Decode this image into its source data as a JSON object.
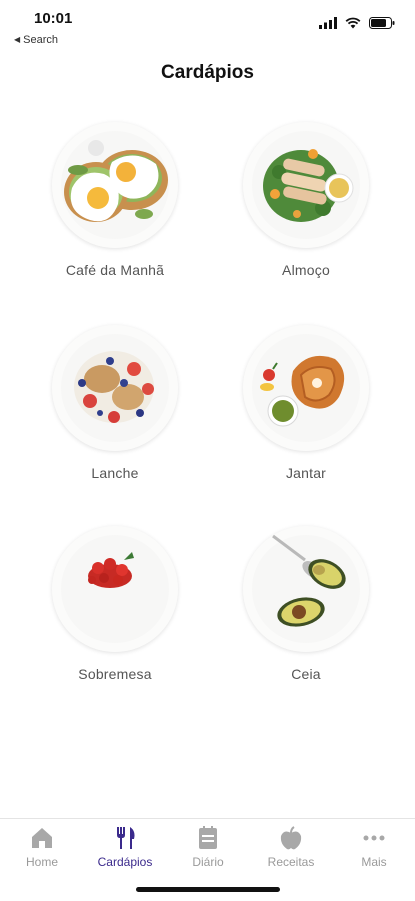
{
  "status_bar": {
    "time": "10:01",
    "back_label": "Search"
  },
  "page": {
    "title": "Cardápios"
  },
  "menus": [
    {
      "label": "Café da Manhã",
      "image": "breakfast-eggs-plate"
    },
    {
      "label": "Almoço",
      "image": "salad-chicken-plate"
    },
    {
      "label": "Lanche",
      "image": "granola-berries-plate"
    },
    {
      "label": "Jantar",
      "image": "salmon-steak-plate"
    },
    {
      "label": "Sobremesa",
      "image": "berry-dessert-plate"
    },
    {
      "label": "Ceia",
      "image": "avocado-plate"
    }
  ],
  "tab_bar": {
    "items": [
      {
        "label": "Home",
        "icon": "home-icon",
        "active": false
      },
      {
        "label": "Cardápios",
        "icon": "fork-knife-icon",
        "active": true
      },
      {
        "label": "Diário",
        "icon": "notebook-icon",
        "active": false
      },
      {
        "label": "Receitas",
        "icon": "apple-icon",
        "active": false
      },
      {
        "label": "Mais",
        "icon": "more-dots-icon",
        "active": false
      }
    ]
  },
  "colors": {
    "accent": "#3b2a8c",
    "inactive": "#9a9a9a"
  }
}
